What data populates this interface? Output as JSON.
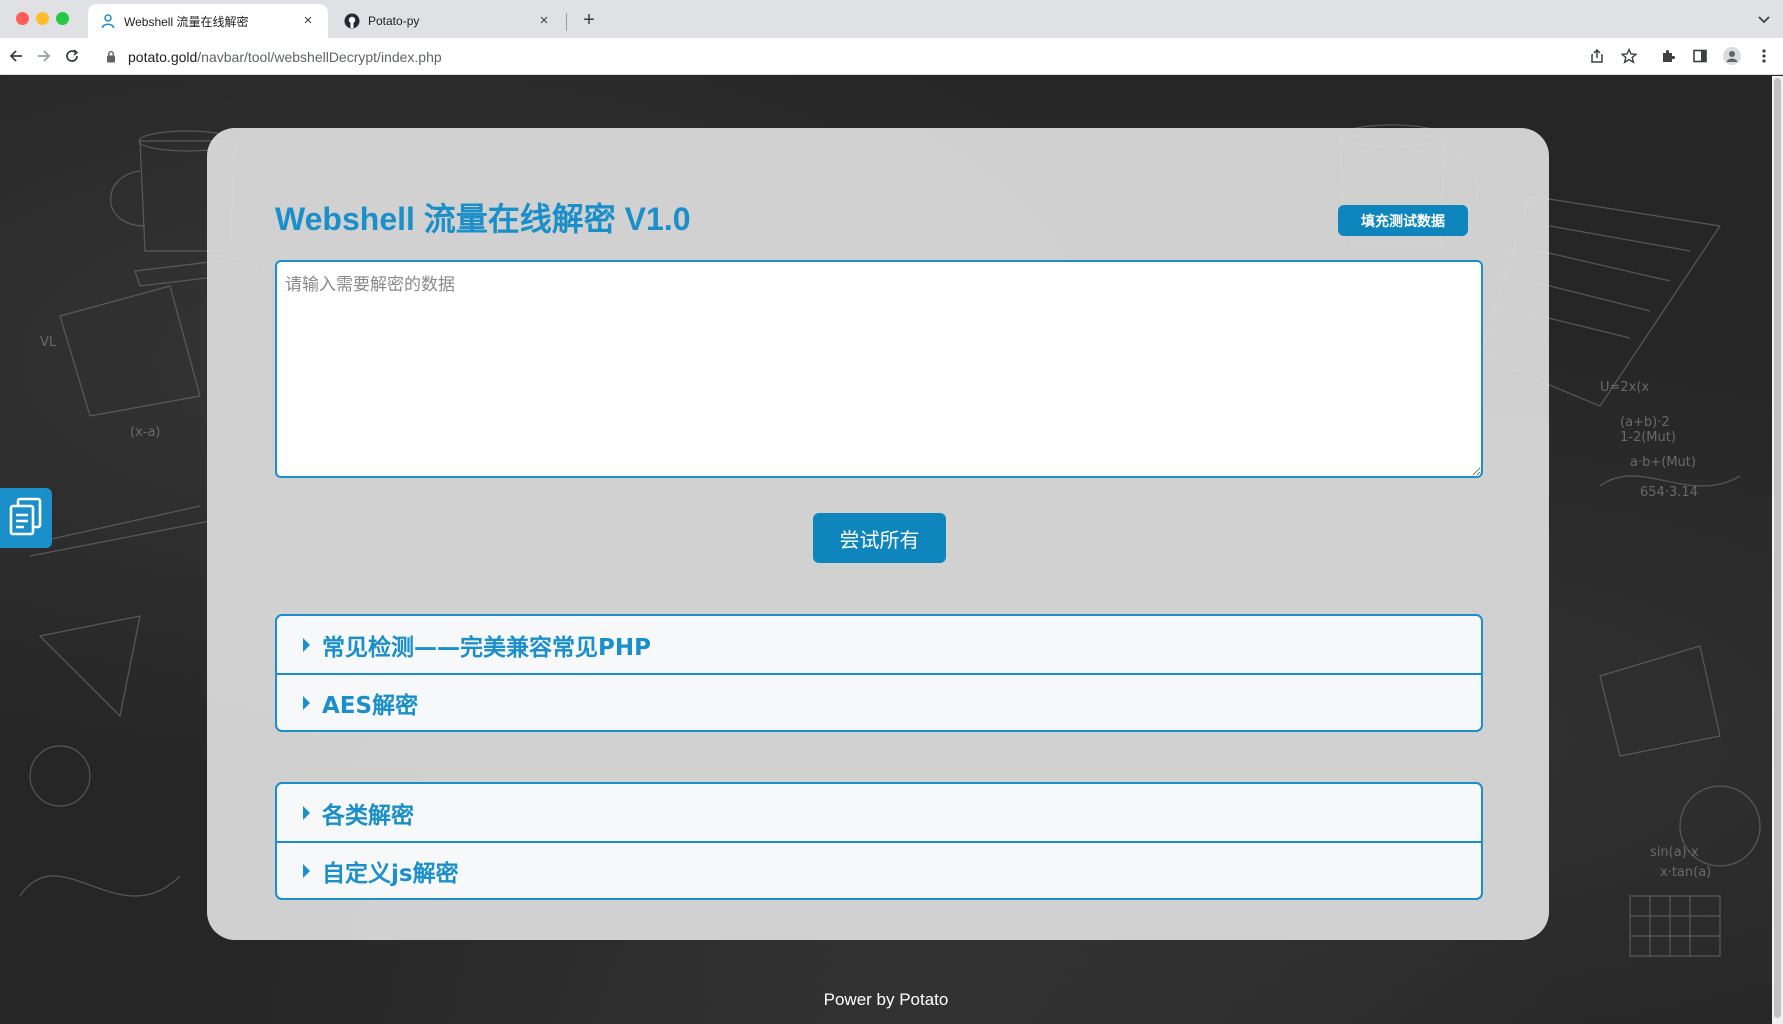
{
  "browser": {
    "tabs": [
      {
        "title": "Webshell 流量在线解密",
        "active": true,
        "icon": "shield-person-icon"
      },
      {
        "title": "Potato-py",
        "active": false,
        "icon": "github-icon"
      }
    ],
    "url_host": "potato.gold",
    "url_path": "/navbar/tool/webshellDecrypt/index.php"
  },
  "page": {
    "title": "Webshell 流量在线解密 V1.0",
    "fill_test_button": "填充测试数据",
    "input_placeholder": "请输入需要解密的数据",
    "try_all_button": "尝试所有",
    "accordion_group_1": [
      {
        "label": "常见检测——完美兼容常见PHP"
      },
      {
        "label": "AES解密"
      }
    ],
    "accordion_group_2": [
      {
        "label": "各类解密"
      },
      {
        "label": "自定义js解密"
      }
    ],
    "footer": "Power by Potato"
  },
  "colors": {
    "accent": "#1a8fc9",
    "button": "#0e85bd",
    "card_bg": "#dedede",
    "page_bg": "#262626"
  }
}
